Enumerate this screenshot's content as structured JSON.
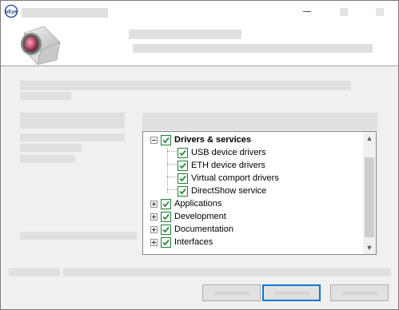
{
  "tree": {
    "items": [
      {
        "label": "Drivers & services",
        "checked": true,
        "expanded": true,
        "level": 0,
        "bold": true
      },
      {
        "label": "USB device drivers",
        "checked": true,
        "level": 1
      },
      {
        "label": "ETH device drivers",
        "checked": true,
        "level": 1
      },
      {
        "label": "Virtual comport drivers",
        "checked": true,
        "level": 1
      },
      {
        "label": "DirectShow service",
        "checked": true,
        "level": 1
      },
      {
        "label": "Applications",
        "checked": true,
        "expanded": false,
        "level": 0
      },
      {
        "label": "Development",
        "checked": true,
        "expanded": false,
        "level": 0
      },
      {
        "label": "Documentation",
        "checked": true,
        "expanded": false,
        "level": 0
      },
      {
        "label": "Interfaces",
        "checked": true,
        "expanded": false,
        "level": 0
      }
    ]
  },
  "colors": {
    "check": "#2e8b3d",
    "focus": "#0078d7"
  },
  "icons": {
    "app": "ueye-app-icon",
    "logo": "camera-logo"
  }
}
